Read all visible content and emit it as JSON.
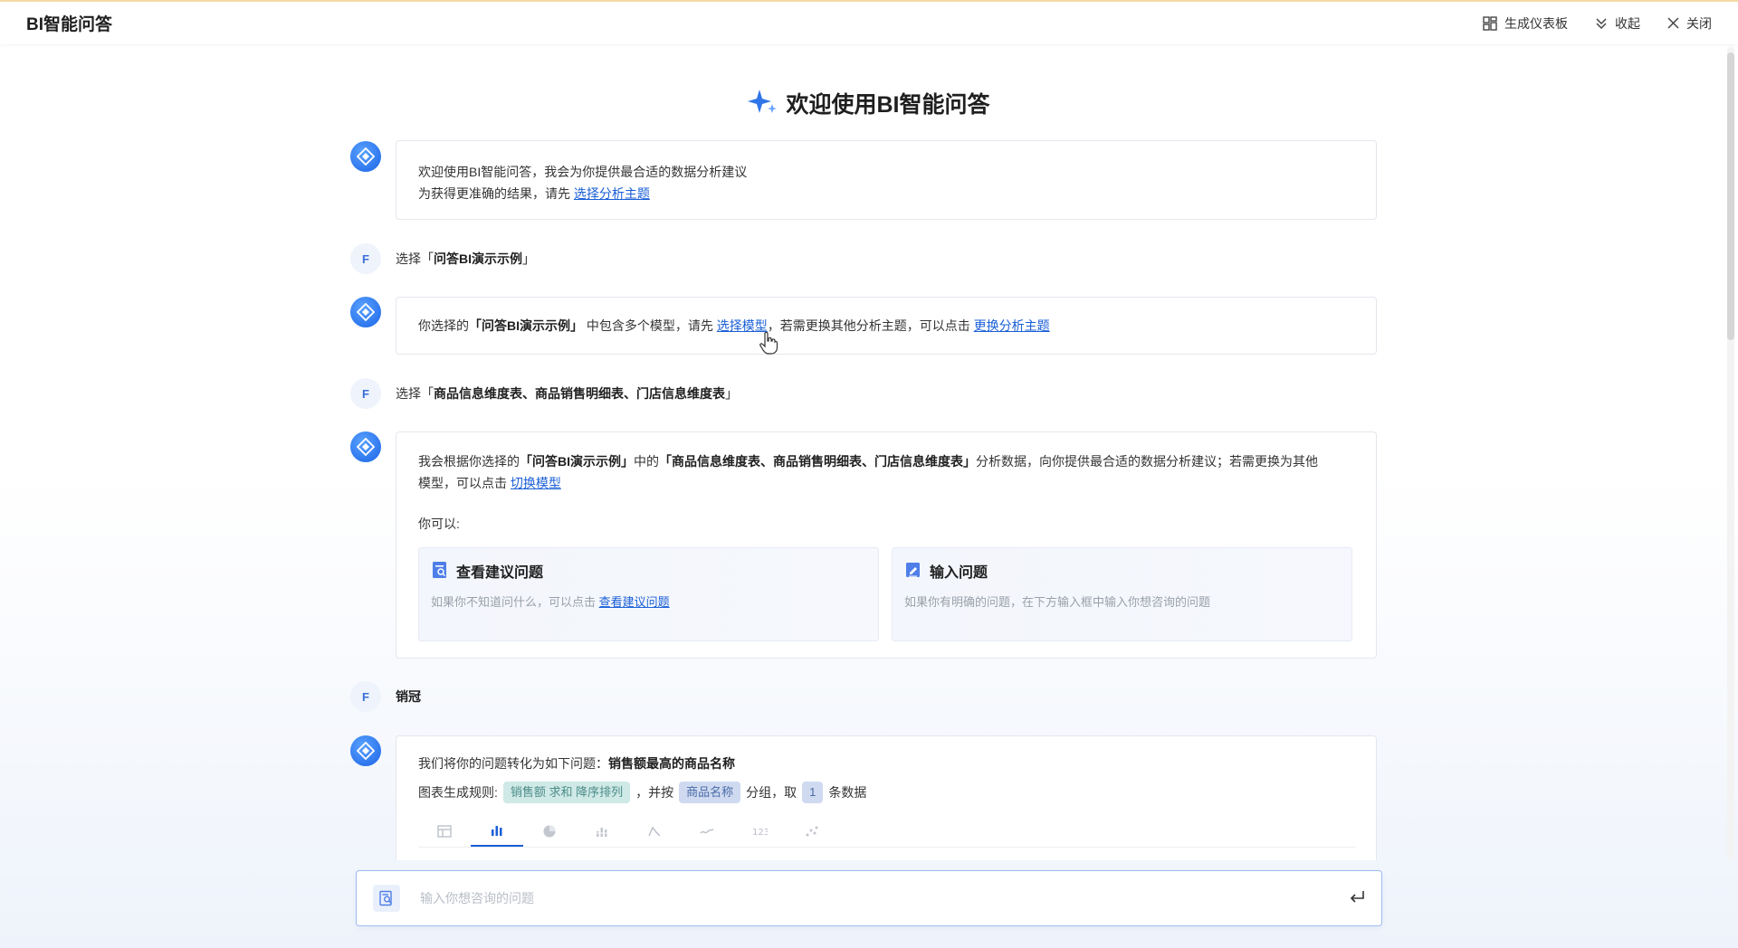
{
  "header": {
    "title": "BI智能问答",
    "actions": [
      {
        "label": "生成仪表板",
        "icon": "dashboard-icon"
      },
      {
        "label": "收起",
        "icon": "collapse-icon"
      },
      {
        "label": "关闭",
        "icon": "close-icon"
      }
    ]
  },
  "welcome": {
    "title": "欢迎使用BI智能问答"
  },
  "messages": {
    "m1": {
      "line1": "欢迎使用BI智能问答，我会为你提供最合适的数据分析建议",
      "line2_prefix": "为获得更准确的结果，请先 ",
      "line2_link": "选择分析主题"
    },
    "u1": {
      "avatar": "F",
      "prefix": "选择「",
      "bold": "问答BI演示示例",
      "suffix": "」"
    },
    "m2": {
      "p1": "你选择的",
      "bold1": "「问答BI演示示例」",
      "p2": "中包含多个模型，请先",
      "link1": "选择模型",
      "p3": "，若需更换其他分析主题，可以点击 ",
      "link2": "更换分析主题"
    },
    "u2": {
      "avatar": "F",
      "prefix": "选择「",
      "bold": "商品信息维度表、商品销售明细表、门店信息维度表",
      "suffix": "」"
    },
    "m3": {
      "p1": "我会根据你选择的",
      "bold1": "「问答BI演示示例」",
      "p2": "中的",
      "bold2": "「商品信息维度表、商品销售明细表、门店信息维度表」",
      "p3": "分析数据，向你提供最合适的数据分析建议；若需更换为其他",
      "p4": "模型，可以点击 ",
      "link": "切换模型",
      "you_can": "你可以:",
      "cards": [
        {
          "title": "查看建议问题",
          "desc_prefix": "如果你不知道问什么，可以点击 ",
          "desc_link": "查看建议问题"
        },
        {
          "title": "输入问题",
          "desc_prefix": "如果你有明确的问题，在下方输入框中输入你想咨询的问题",
          "desc_link": ""
        }
      ]
    },
    "u3": {
      "avatar": "F",
      "text": "销冠"
    },
    "m4": {
      "prefix": "我们将你的问题转化为如下问题：",
      "question": "销售额最高的商品名称",
      "rule_label": "图表生成规则:",
      "tag1": "销售额 求和 降序排列",
      "sep1": "，并按",
      "tag2": "商品名称",
      "sep2": "分组，取",
      "tag3": "1",
      "sep3": "条数据"
    }
  },
  "chart_types": [
    "table-icon",
    "bar-chart-icon",
    "pie-chart-icon",
    "stacked-bar-icon",
    "line-chart-icon",
    "area-chart-icon",
    "number-card-icon",
    "scatter-icon"
  ],
  "input": {
    "placeholder": "输入你想咨询的问题"
  },
  "colors": {
    "accent": "#1a5fd6",
    "bot_avatar": "#1a63e6",
    "tag_green": "#cfe9e6",
    "tag_blue": "#cfdaf0"
  }
}
